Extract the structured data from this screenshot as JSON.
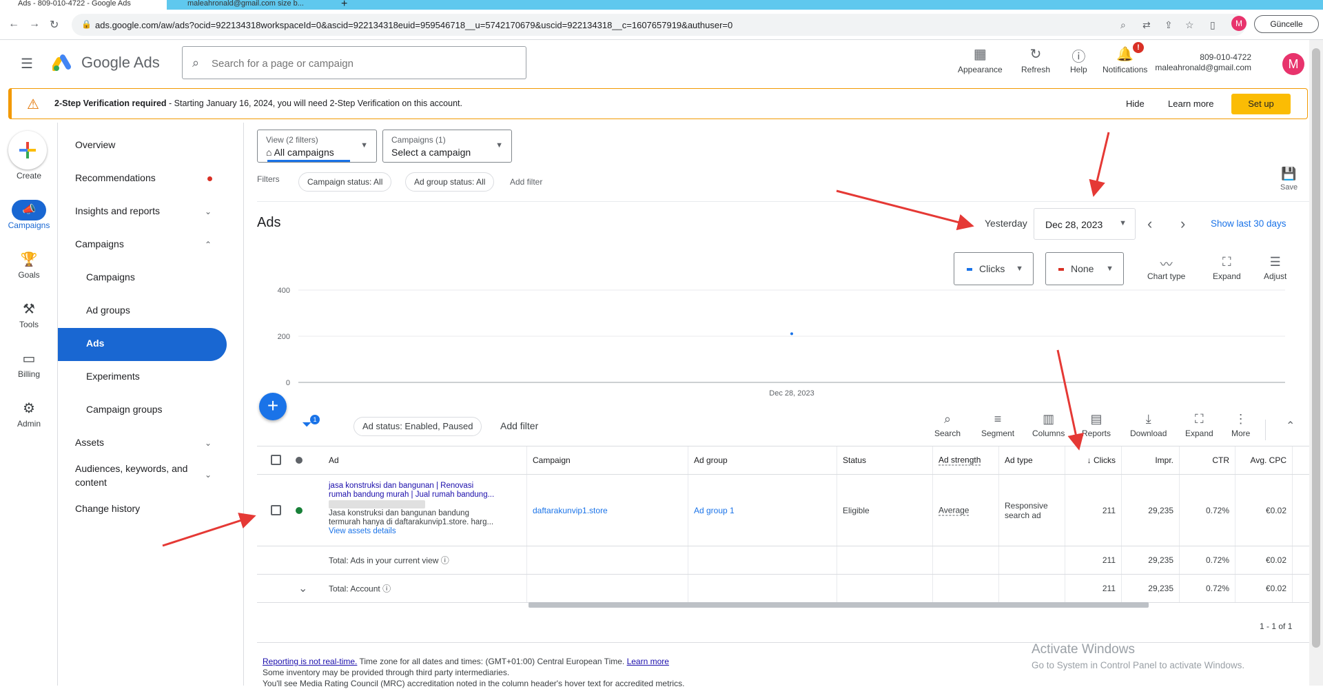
{
  "browser": {
    "tabs": [
      {
        "label": "Ads - 809-010-4722 - Google Ads"
      },
      {
        "label": "maleahronald@gmail.com size b..."
      }
    ],
    "url": "ads.google.com/aw/ads?ocid=922134318workspaceId=0&ascid=922134318euid=959546718__u=5742170679&uscid=922134318__c=1607657919&authuser=0",
    "update_label": "Güncelle"
  },
  "header": {
    "brand": "Google Ads",
    "search_placeholder": "Search for a page or campaign",
    "buttons": {
      "appearance": "Appearance",
      "refresh": "Refresh",
      "help": "Help",
      "notifications": "Notifications"
    },
    "notification_count": "!",
    "account_id": "809-010-4722",
    "account_email": "maleahronald@gmail.com",
    "avatar_letter": "M"
  },
  "banner": {
    "bold": "2-Step Verification required",
    "text": " - Starting January 16, 2024, you will need 2-Step Verification on this account.",
    "hide": "Hide",
    "learn_more": "Learn more",
    "setup": "Set up"
  },
  "rail": {
    "create": "Create",
    "campaigns": "Campaigns",
    "goals": "Goals",
    "tools": "Tools",
    "billing": "Billing",
    "admin": "Admin"
  },
  "sidenav": {
    "overview": "Overview",
    "recommendations": "Recommendations",
    "insights": "Insights and reports",
    "campaigns_group": "Campaigns",
    "campaigns": "Campaigns",
    "ad_groups": "Ad groups",
    "ads": "Ads",
    "experiments": "Experiments",
    "campaign_groups": "Campaign groups",
    "assets": "Assets",
    "audiences_line1": "Audiences, keywords, and",
    "audiences_line2": "content",
    "change_history": "Change history"
  },
  "main": {
    "view_small": "View (2 filters)",
    "view_big": "All campaigns",
    "campaign_small": "Campaigns (1)",
    "campaign_big": "Select a campaign",
    "filters_label": "Filters",
    "chip_campaign_status": "Campaign status: All",
    "chip_adgroup_status": "Ad group status: All",
    "add_filter": "Add filter",
    "save": "Save",
    "title": "Ads",
    "date_preset": "Yesterday",
    "date_value": "Dec 28, 2023",
    "show_last_30": "Show last 30 days",
    "metric1": "Clicks",
    "metric2": "None",
    "chart_type": "Chart type",
    "expand": "Expand",
    "adjust": "Adjust"
  },
  "chart_data": {
    "type": "line",
    "x": [
      "Dec 28, 2023"
    ],
    "series": [
      {
        "name": "Clicks",
        "values": [
          211
        ]
      }
    ],
    "yticks": [
      0,
      200,
      400
    ],
    "ylim": [
      0,
      400
    ],
    "color": "#1a73e8"
  },
  "table_toolbar": {
    "filter_badge": "1",
    "chip_ad_status": "Ad status: Enabled, Paused",
    "add_filter": "Add filter",
    "search": "Search",
    "segment": "Segment",
    "columns": "Columns",
    "reports": "Reports",
    "download": "Download",
    "expand": "Expand",
    "more": "More"
  },
  "table": {
    "headers": {
      "ad": "Ad",
      "campaign": "Campaign",
      "ad_group": "Ad group",
      "status": "Status",
      "ad_strength": "Ad strength",
      "ad_type": "Ad type",
      "clicks": "Clicks",
      "impr": "Impr.",
      "ctr": "CTR",
      "avg_cpc": "Avg. CPC"
    },
    "row": {
      "headline1": "jasa konstruksi dan bangunan | Renovasi",
      "headline2": "rumah bandung murah | Jual rumah bandung...",
      "desc1": "Jasa konstruksi dan bangunan bandung",
      "desc2": "termurah hanya di daftarakunvip1.store. harg...",
      "view_assets": "View assets details",
      "campaign": "daftarakunvip1.store",
      "ad_group": "Ad group 1",
      "status": "Eligible",
      "ad_strength": "Average",
      "ad_type_1": "Responsive",
      "ad_type_2": "search ad",
      "clicks": "211",
      "impr": "29,235",
      "ctr": "0.72%",
      "avg_cpc": "€0.02"
    },
    "total_view": {
      "label": "Total: Ads in your current view",
      "clicks": "211",
      "impr": "29,235",
      "ctr": "0.72%",
      "avg_cpc": "€0.02"
    },
    "total_account": {
      "label": "Total: Account",
      "clicks": "211",
      "impr": "29,235",
      "ctr": "0.72%",
      "avg_cpc": "€0.02"
    },
    "pager": "1 - 1 of 1"
  },
  "footer": {
    "link1": "Reporting is not real-time.",
    "text1": " Time zone for all dates and times: (GMT+01:00) Central European Time. ",
    "link2": "Learn more",
    "line2": "Some inventory may be provided through third party intermediaries.",
    "line3": "You'll see Media Rating Council (MRC) accreditation noted in the column header's hover text for accredited metrics."
  },
  "activate": {
    "title": "Activate Windows",
    "sub": "Go to System in Control Panel to activate Windows."
  }
}
